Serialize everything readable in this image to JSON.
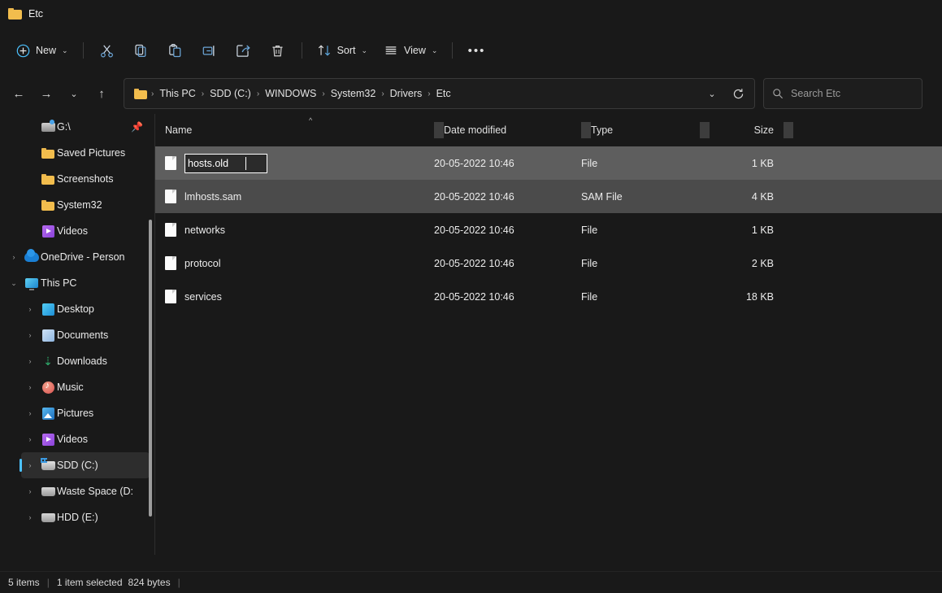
{
  "window": {
    "title": "Etc",
    "folder_icon": "folder-icon"
  },
  "toolbar": {
    "new_label": "New",
    "new_chevron": "⌄",
    "items": [
      {
        "name": "cut-button",
        "icon": "scissors-icon"
      },
      {
        "name": "copy-button",
        "icon": "copy-icon"
      },
      {
        "name": "paste-button",
        "icon": "clipboard-icon"
      },
      {
        "name": "rename-button",
        "icon": "rename-icon"
      },
      {
        "name": "share-button",
        "icon": "share-icon"
      },
      {
        "name": "delete-button",
        "icon": "trash-icon"
      }
    ],
    "sort_label": "Sort",
    "view_label": "View",
    "more_label": "•••"
  },
  "address": {
    "back": "←",
    "forward": "→",
    "recent": "⌄",
    "up": "↑",
    "crumbs": [
      "This PC",
      "SDD (C:)",
      "WINDOWS",
      "System32",
      "Drivers",
      "Etc"
    ],
    "separator": "›",
    "dropdown": "⌄",
    "refresh": "↻"
  },
  "search": {
    "icon": "search-icon",
    "placeholder": "Search Etc",
    "value": ""
  },
  "sidebar": {
    "items": [
      {
        "label": "G:\\",
        "icon": "network-drive-icon",
        "indent": 1,
        "expand": "",
        "pinned": true,
        "selected": false
      },
      {
        "label": "Saved Pictures",
        "icon": "folder-icon",
        "indent": 1,
        "expand": "",
        "pinned": false,
        "selected": false
      },
      {
        "label": "Screenshots",
        "icon": "folder-icon",
        "indent": 1,
        "expand": "",
        "pinned": false,
        "selected": false
      },
      {
        "label": "System32",
        "icon": "folder-icon",
        "indent": 1,
        "expand": "",
        "pinned": false,
        "selected": false
      },
      {
        "label": "Videos",
        "icon": "video-folder-icon",
        "indent": 1,
        "expand": "",
        "pinned": false,
        "selected": false
      },
      {
        "label": "OneDrive - Person",
        "icon": "onedrive-cloud-icon",
        "indent": 0,
        "expand": "›",
        "pinned": false,
        "selected": false
      },
      {
        "label": "This PC",
        "icon": "this-pc-icon",
        "indent": 0,
        "expand": "⌄",
        "pinned": false,
        "selected": false
      },
      {
        "label": "Desktop",
        "icon": "desktop-icon",
        "indent": 1,
        "expand": "›",
        "pinned": false,
        "selected": false
      },
      {
        "label": "Documents",
        "icon": "documents-icon",
        "indent": 1,
        "expand": "›",
        "pinned": false,
        "selected": false
      },
      {
        "label": "Downloads",
        "icon": "downloads-icon",
        "indent": 1,
        "expand": "›",
        "pinned": false,
        "selected": false
      },
      {
        "label": "Music",
        "icon": "music-icon",
        "indent": 1,
        "expand": "›",
        "pinned": false,
        "selected": false
      },
      {
        "label": "Pictures",
        "icon": "pictures-icon",
        "indent": 1,
        "expand": "›",
        "pinned": false,
        "selected": false
      },
      {
        "label": "Videos",
        "icon": "video-folder-icon",
        "indent": 1,
        "expand": "›",
        "pinned": false,
        "selected": false
      },
      {
        "label": "SDD (C:)",
        "icon": "system-drive-icon",
        "indent": 1,
        "expand": "›",
        "pinned": false,
        "selected": true
      },
      {
        "label": "Waste Space (D:",
        "icon": "drive-icon",
        "indent": 1,
        "expand": "›",
        "pinned": false,
        "selected": false
      },
      {
        "label": "HDD (E:)",
        "icon": "drive-icon",
        "indent": 1,
        "expand": "›",
        "pinned": false,
        "selected": false
      }
    ]
  },
  "filelist": {
    "columns": [
      "Name",
      "Date modified",
      "Type",
      "Size"
    ],
    "sort_column": "Name",
    "sort_direction": "ascending",
    "rows": [
      {
        "name": "hosts.old",
        "date": "20-05-2022 10:46",
        "type": "File",
        "size": "1 KB",
        "state": "renaming",
        "icon": "file-icon"
      },
      {
        "name": "lmhosts.sam",
        "date": "20-05-2022 10:46",
        "type": "SAM File",
        "size": "4 KB",
        "state": "selected",
        "icon": "file-icon"
      },
      {
        "name": "networks",
        "date": "20-05-2022 10:46",
        "type": "File",
        "size": "1 KB",
        "state": "normal",
        "icon": "file-icon"
      },
      {
        "name": "protocol",
        "date": "20-05-2022 10:46",
        "type": "File",
        "size": "2 KB",
        "state": "normal",
        "icon": "file-icon"
      },
      {
        "name": "services",
        "date": "20-05-2022 10:46",
        "type": "File",
        "size": "18 KB",
        "state": "normal",
        "icon": "file-icon"
      }
    ]
  },
  "statusbar": {
    "item_count": "5 items",
    "selection": "1 item selected",
    "selection_size": "824 bytes",
    "separator": "|"
  },
  "colors": {
    "background": "#191919",
    "accent": "#4cc2ff",
    "folder": "#f2bd4d",
    "row_rename": "#5e5e5e",
    "row_selected": "#4b4b4b",
    "text": "#ececec"
  }
}
